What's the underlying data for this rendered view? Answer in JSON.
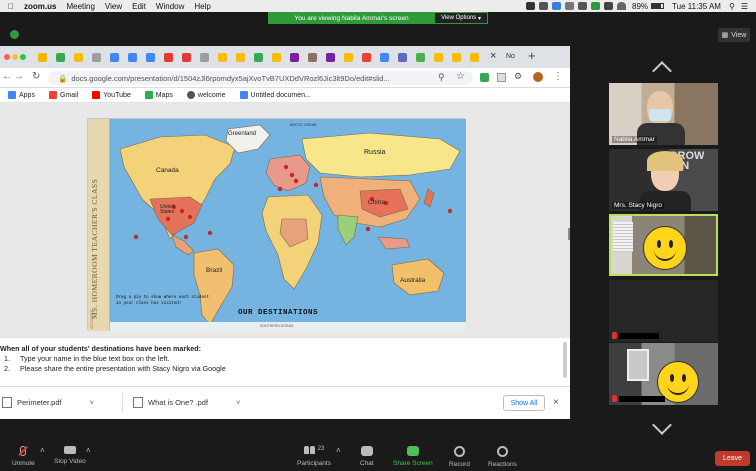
{
  "mac_menubar": {
    "app": "zoom.us",
    "menus": [
      "Meeting",
      "View",
      "Edit",
      "Window",
      "Help"
    ],
    "battery": "89%",
    "clock": "Tue 11:35 AM"
  },
  "zoom": {
    "banner_text": "You are viewing Nabila Ammar's screen",
    "view_options": "View Options",
    "view_button": "View",
    "participants": [
      {
        "name": "Nabila Ammar"
      },
      {
        "name": "Mrs. Stacy Nigro"
      },
      {
        "name": ""
      },
      {
        "name": ""
      },
      {
        "name": ""
      }
    ],
    "tile_bg_text": "GROW\nMIN",
    "toolbar": {
      "unmute": "Unmute",
      "stop_video": "Stop Video",
      "participants": "Participants",
      "participant_count": "23",
      "chat": "Chat",
      "share_screen": "Share Screen",
      "record": "Record",
      "reactions": "Reactions",
      "leave": "Leave"
    }
  },
  "browser": {
    "url": "docs.google.com/presentation/d/1504zJl6rpomdyx5ajXvoTvB7UXDdVRozl6Jic3lt9Do/edit#slid...",
    "tab_label": "No",
    "bookmarks": [
      {
        "label": "Apps",
        "icon": "apps-grid-icon",
        "color": "#4285f4"
      },
      {
        "label": "Gmail",
        "icon": "gmail-icon",
        "color": "#ea4335"
      },
      {
        "label": "YouTube",
        "icon": "youtube-icon",
        "color": "#ff0000"
      },
      {
        "label": "Maps",
        "icon": "maps-icon",
        "color": "#34a853"
      },
      {
        "label": "welcome",
        "icon": "globe-icon",
        "color": "#555555"
      },
      {
        "label": "Untitled documen...",
        "icon": "docs-icon",
        "color": "#4285f4"
      }
    ],
    "downloads": [
      {
        "name": "Perimeter.pdf"
      },
      {
        "name": "What is One? .pdf"
      }
    ],
    "show_all": "Show All"
  },
  "slide": {
    "side_title": "MS. HOMEROOM TEACHER'S CLASS",
    "map_title": "OUR DESTINATIONS",
    "instruction": "Drag a pin to show where each student in your class has visited!",
    "labels": {
      "greenland": "Greenland",
      "canada": "Canada",
      "united_states": "United States",
      "russia": "Russia",
      "china": "China",
      "brazil": "Brazil",
      "australia": "Australia",
      "arctic": "ARCTIC OCEAN",
      "southern": "SOUTHERN OCEAN"
    },
    "side_small": "ACTIVITIES"
  },
  "notes": {
    "title": "When all of your students' destinations have been marked:",
    "steps": [
      {
        "num": "1.",
        "text": "Type your name in the blue text box on the left."
      },
      {
        "num": "2.",
        "text": "Please share the entire presentation with Stacy Nigro via Google"
      }
    ]
  }
}
